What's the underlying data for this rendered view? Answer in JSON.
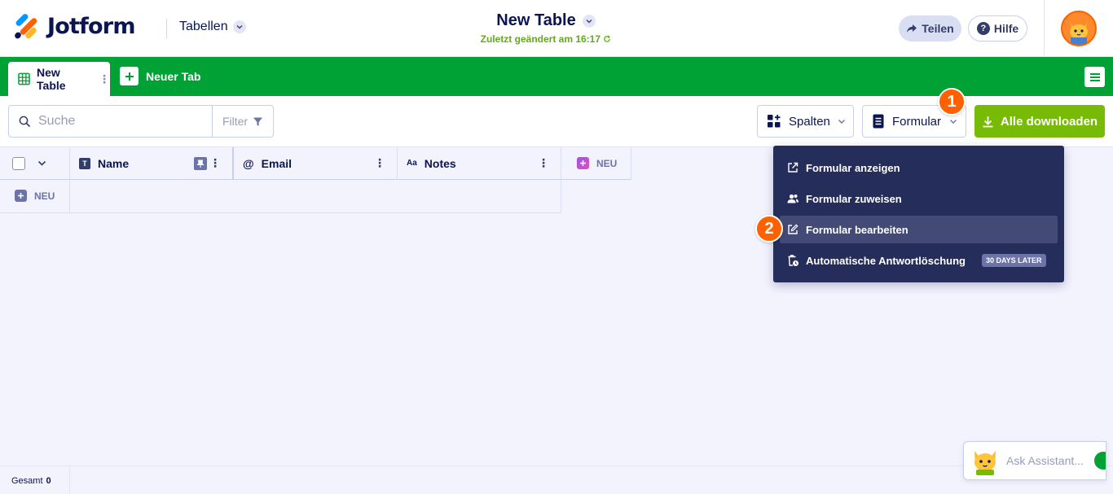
{
  "header": {
    "brand": "Jotform",
    "product_switcher": "Tabellen",
    "table_title": "New Table",
    "last_saved": "Zuletzt geändert am 16:17",
    "share_label": "Teilen",
    "help_label": "Hilfe"
  },
  "tabs": {
    "active_tab": "New Table",
    "new_tab_label": "Neuer Tab"
  },
  "toolbar": {
    "search_placeholder": "Suche",
    "filter_label": "Filter",
    "columns_label": "Spalten",
    "form_label": "Formular",
    "download_label": "Alle downloaden"
  },
  "grid": {
    "columns": [
      {
        "label": "Name",
        "type_icon": "T"
      },
      {
        "label": "Email",
        "type_icon": "@"
      },
      {
        "label": "Notes",
        "type_icon": "Aa"
      }
    ],
    "new_column_label": "NEU",
    "new_row_label": "NEU"
  },
  "form_menu": {
    "items": [
      {
        "label": "Formular anzeigen",
        "icon": "external-link-icon"
      },
      {
        "label": "Formular zuweisen",
        "icon": "assign-users-icon"
      },
      {
        "label": "Formular bearbeiten",
        "icon": "edit-icon"
      },
      {
        "label": "Automatische Antwortlöschung",
        "icon": "trash-clock-icon",
        "badge": "30 DAYS LATER"
      }
    ],
    "highlighted_index": 2
  },
  "markers": {
    "first": "1",
    "second": "2"
  },
  "footer": {
    "total_label": "Gesamt",
    "total_value": "0"
  },
  "assistant": {
    "placeholder": "Ask Assistant..."
  },
  "colors": {
    "brand_green": "#01a235",
    "download_green": "#78bb07",
    "navy": "#0a1551",
    "dropdown_bg": "#252d5b",
    "marker_orange": "#ff6100"
  }
}
